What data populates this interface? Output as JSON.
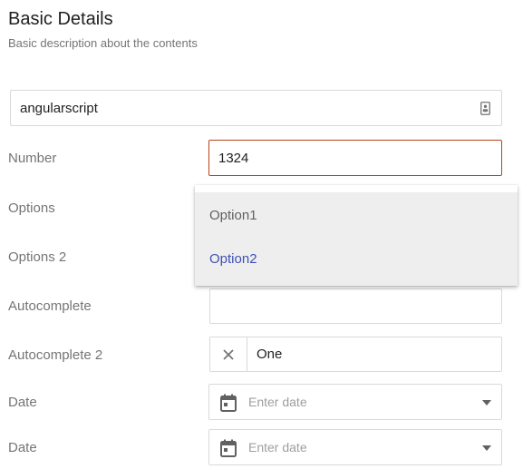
{
  "header": {
    "title": "Basic Details",
    "subtitle": "Basic description about the contents"
  },
  "form": {
    "name_input": {
      "value": "angularscript",
      "icon": "contact-card-icon"
    },
    "number": {
      "label": "Number",
      "value": "1324",
      "border_color": "#b8431b"
    },
    "options": {
      "label": "Options"
    },
    "options2": {
      "label": "Options 2"
    },
    "autocomplete": {
      "label": "Autocomplete",
      "value": ""
    },
    "autocomplete2": {
      "label": "Autocomplete 2",
      "value": "One",
      "clear_icon": "close-icon"
    },
    "date1": {
      "label": "Date",
      "placeholder": "Enter date",
      "icon": "calendar-icon"
    },
    "date2": {
      "label": "Date",
      "placeholder": "Enter date",
      "icon": "calendar-icon"
    }
  },
  "dropdown": {
    "options": [
      "Option1",
      "Option2"
    ],
    "selected": "Option2",
    "selected_color": "#3f51b5"
  }
}
